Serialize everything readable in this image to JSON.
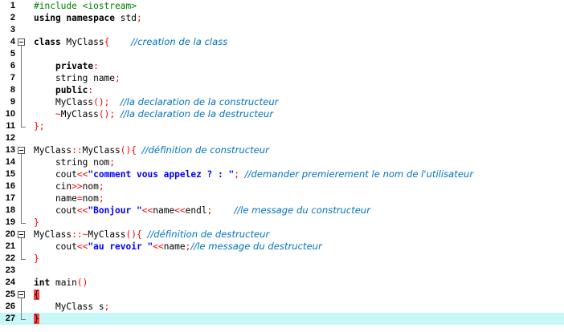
{
  "editor": {
    "lines": [
      {
        "num": "1",
        "tokens": [
          [
            "pp",
            "#include <iostream>"
          ]
        ]
      },
      {
        "num": "2",
        "tokens": [
          [
            "kw",
            "using namespace"
          ],
          [
            "n",
            " std"
          ],
          [
            "op",
            ";"
          ]
        ]
      },
      {
        "num": "3",
        "tokens": []
      },
      {
        "num": "4",
        "tokens": [
          [
            "kw",
            "class"
          ],
          [
            "n",
            " MyClass"
          ],
          [
            "op",
            "{"
          ],
          [
            "n",
            "    "
          ],
          [
            "cm",
            "//creation de la class"
          ]
        ]
      },
      {
        "num": "5",
        "tokens": []
      },
      {
        "num": "6",
        "tokens": [
          [
            "n",
            "    "
          ],
          [
            "kw",
            "private"
          ],
          [
            "op",
            ":"
          ]
        ]
      },
      {
        "num": "7",
        "tokens": [
          [
            "n",
            "    string name"
          ],
          [
            "op",
            ";"
          ]
        ]
      },
      {
        "num": "8",
        "tokens": [
          [
            "n",
            "    "
          ],
          [
            "kw",
            "public"
          ],
          [
            "op",
            ":"
          ]
        ]
      },
      {
        "num": "9",
        "tokens": [
          [
            "n",
            "    MyClass"
          ],
          [
            "op",
            "();"
          ],
          [
            "n",
            "  "
          ],
          [
            "cm",
            "//la declaration de la constructeur"
          ]
        ]
      },
      {
        "num": "10",
        "tokens": [
          [
            "n",
            "    "
          ],
          [
            "op",
            "~"
          ],
          [
            "n",
            "MyClass"
          ],
          [
            "op",
            "();"
          ],
          [
            "n",
            " "
          ],
          [
            "cm",
            "//la declaration de la destructeur"
          ]
        ]
      },
      {
        "num": "11",
        "tokens": [
          [
            "op",
            "};"
          ]
        ]
      },
      {
        "num": "12",
        "tokens": []
      },
      {
        "num": "13",
        "tokens": [
          [
            "n",
            "MyClass"
          ],
          [
            "op",
            "::"
          ],
          [
            "n",
            "MyClass"
          ],
          [
            "op",
            "(){"
          ],
          [
            "n",
            " "
          ],
          [
            "cm",
            "//définition de constructeur"
          ]
        ]
      },
      {
        "num": "14",
        "tokens": [
          [
            "n",
            "    string nom"
          ],
          [
            "op",
            ";"
          ]
        ]
      },
      {
        "num": "15",
        "tokens": [
          [
            "n",
            "    cout"
          ],
          [
            "op",
            "<<"
          ],
          [
            "str",
            "\"comment vous appelez ? : \""
          ],
          [
            "op",
            ";"
          ],
          [
            "n",
            " "
          ],
          [
            "cm",
            "//demander premierement le nom de l'utilisateur"
          ]
        ]
      },
      {
        "num": "16",
        "tokens": [
          [
            "n",
            "    cin"
          ],
          [
            "op",
            ">>"
          ],
          [
            "n",
            "nom"
          ],
          [
            "op",
            ";"
          ]
        ]
      },
      {
        "num": "17",
        "tokens": [
          [
            "n",
            "    name"
          ],
          [
            "op",
            "="
          ],
          [
            "n",
            "nom"
          ],
          [
            "op",
            ";"
          ]
        ]
      },
      {
        "num": "18",
        "tokens": [
          [
            "n",
            "    cout"
          ],
          [
            "op",
            "<<"
          ],
          [
            "str",
            "\"Bonjour \""
          ],
          [
            "op",
            "<<"
          ],
          [
            "n",
            "name"
          ],
          [
            "op",
            "<<"
          ],
          [
            "n",
            "endl"
          ],
          [
            "op",
            ";"
          ],
          [
            "n",
            "    "
          ],
          [
            "cm",
            "//le message du constructeur"
          ]
        ]
      },
      {
        "num": "19",
        "tokens": [
          [
            "op",
            "}"
          ]
        ]
      },
      {
        "num": "20",
        "tokens": [
          [
            "n",
            "MyClass"
          ],
          [
            "op",
            "::~"
          ],
          [
            "n",
            "MyClass"
          ],
          [
            "op",
            "(){"
          ],
          [
            "n",
            " "
          ],
          [
            "cm",
            "//définition de destructeur"
          ]
        ]
      },
      {
        "num": "21",
        "tokens": [
          [
            "n",
            "    cout"
          ],
          [
            "op",
            "<<"
          ],
          [
            "str",
            "\"au revoir \""
          ],
          [
            "op",
            "<<"
          ],
          [
            "n",
            "name"
          ],
          [
            "op",
            ";"
          ],
          [
            "cm",
            "//le message du destructeur"
          ]
        ]
      },
      {
        "num": "22",
        "tokens": [
          [
            "op",
            "}"
          ]
        ]
      },
      {
        "num": "23",
        "tokens": []
      },
      {
        "num": "24",
        "tokens": [
          [
            "kw",
            "int"
          ],
          [
            "n",
            " main"
          ],
          [
            "op",
            "()"
          ]
        ]
      },
      {
        "num": "25",
        "tokens": [
          [
            "op",
            "{"
          ]
        ]
      },
      {
        "num": "26",
        "tokens": [
          [
            "n",
            "    MyClass s"
          ],
          [
            "op",
            ";"
          ]
        ]
      },
      {
        "num": "27",
        "tokens": [
          [
            "op",
            "}"
          ]
        ]
      }
    ],
    "current_line": "27",
    "colors": {
      "current_line_bg": "#c8f7f7",
      "operator": "#ff0000",
      "comment": "#0073bf",
      "string": "#0000ff",
      "preprocessor": "#008000"
    }
  }
}
